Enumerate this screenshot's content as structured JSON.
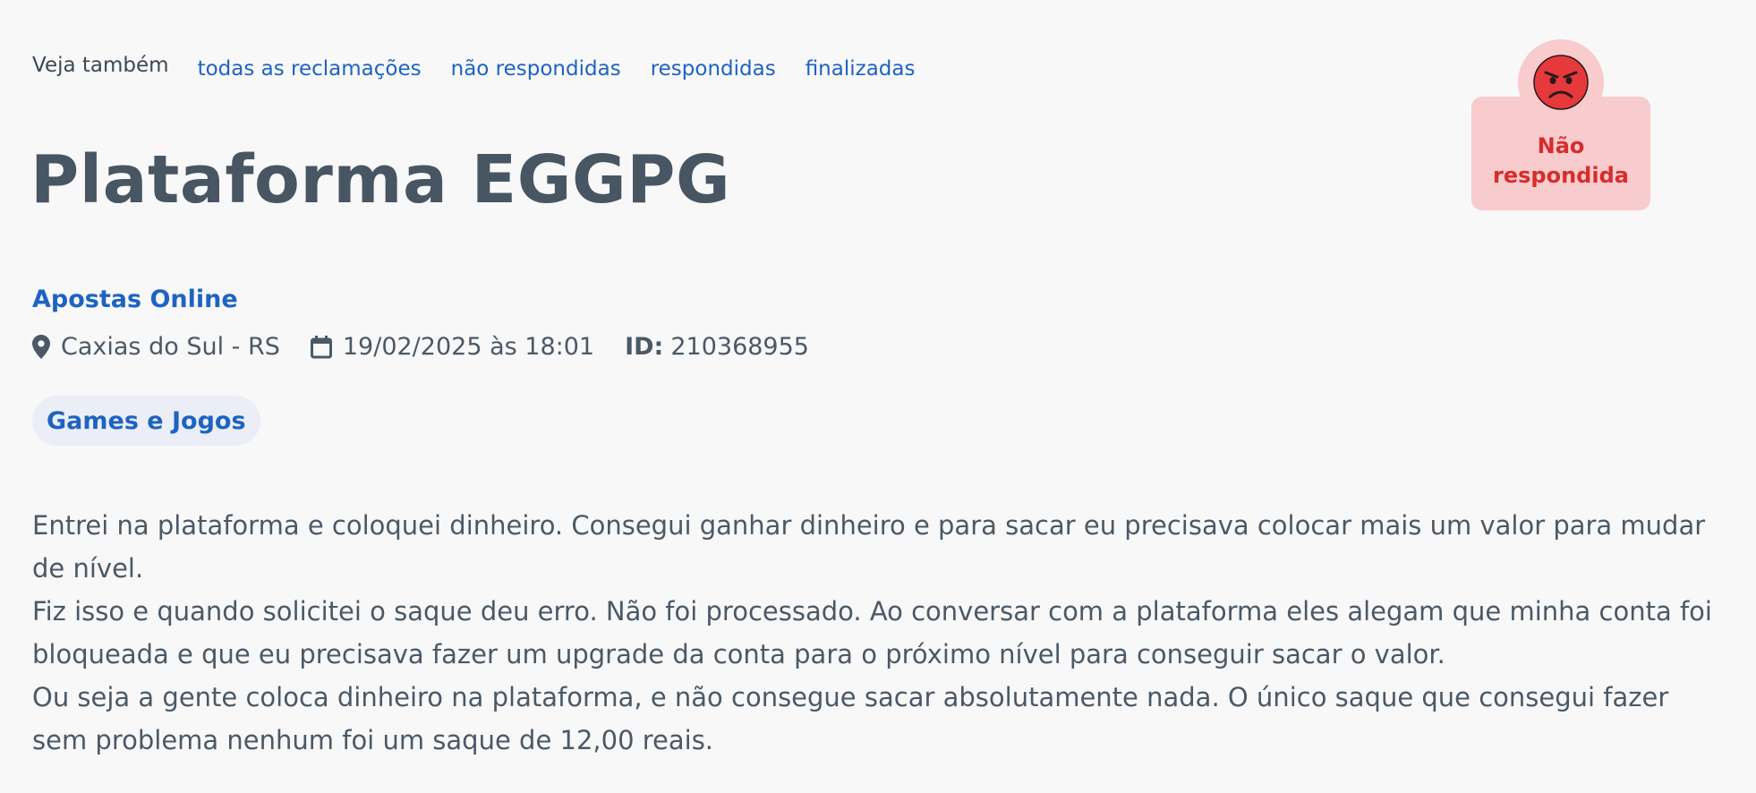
{
  "see_also": {
    "label": "Veja também",
    "links": [
      "todas as reclamações",
      "não respondidas",
      "respondidas",
      "finalizadas"
    ]
  },
  "complaint": {
    "title": "Plataforma EGGPG",
    "company": "Apostas Online",
    "location": "Caxias do Sul - RS",
    "datetime": "19/02/2025 às 18:01",
    "id_label": "ID:",
    "id_value": "210368955",
    "category": "Games e Jogos",
    "body": [
      "Entrei na plataforma e coloquei dinheiro. Consegui ganhar dinheiro e para sacar eu precisava colocar mais um valor para mudar de nível.",
      "Fiz isso e quando solicitei o saque deu erro. Não foi processado. Ao conversar com a plataforma eles alegam que minha conta foi bloqueada e que eu precisava fazer um upgrade da conta para o próximo nível para conseguir sacar o valor.",
      "Ou seja a gente coloca dinheiro na plataforma, e não consegue sacar absolutamente nada. O único saque que consegui fazer sem problema nenhum foi um saque de 12,00 reais."
    ]
  },
  "status": {
    "line1": "Não",
    "line2": "respondida",
    "icon": "angry-face-icon",
    "color": "#d62d2d",
    "background": "#f8cbcd"
  },
  "colors": {
    "link": "#1e63c2",
    "text": "#4b5966",
    "title": "#485663",
    "tag_background": "#ebeef6"
  },
  "icons": {
    "location": "location-pin-icon",
    "date": "calendar-icon"
  }
}
